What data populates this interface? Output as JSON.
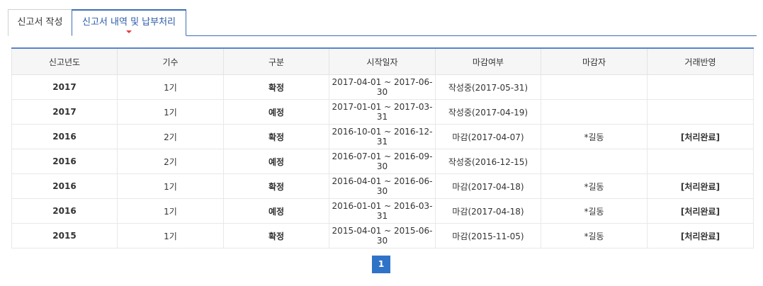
{
  "tabs": [
    {
      "label": "신고서 작성"
    },
    {
      "label": "신고서 내역 및 납부처리"
    }
  ],
  "table": {
    "headers": [
      "신고년도",
      "기수",
      "구분",
      "시작일자",
      "마감여부",
      "마감자",
      "거래반영"
    ],
    "rows": [
      {
        "year": "2017",
        "term": "1기",
        "kind": "확정",
        "period": "2017-04-01 ~ 2017-06-30",
        "status": "작성중(2017-05-31)",
        "closer": "",
        "reflect": ""
      },
      {
        "year": "2017",
        "term": "1기",
        "kind": "예정",
        "period": "2017-01-01 ~ 2017-03-31",
        "status": "작성중(2017-04-19)",
        "closer": "",
        "reflect": ""
      },
      {
        "year": "2016",
        "term": "2기",
        "kind": "확정",
        "period": "2016-10-01 ~ 2016-12-31",
        "status": "마감(2017-04-07)",
        "closer": "*길동",
        "reflect": "[처리완료]"
      },
      {
        "year": "2016",
        "term": "2기",
        "kind": "예정",
        "period": "2016-07-01 ~ 2016-09-30",
        "status": "작성중(2016-12-15)",
        "closer": "",
        "reflect": ""
      },
      {
        "year": "2016",
        "term": "1기",
        "kind": "확정",
        "period": "2016-04-01 ~ 2016-06-30",
        "status": "마감(2017-04-18)",
        "closer": "*길동",
        "reflect": "[처리완료]"
      },
      {
        "year": "2016",
        "term": "1기",
        "kind": "예정",
        "period": "2016-01-01 ~ 2016-03-31",
        "status": "마감(2017-04-18)",
        "closer": "*길동",
        "reflect": "[처리완료]"
      },
      {
        "year": "2015",
        "term": "1기",
        "kind": "확정",
        "period": "2015-04-01 ~ 2015-06-30",
        "status": "마감(2015-11-05)",
        "closer": "*길동",
        "reflect": "[처리완료]"
      }
    ]
  },
  "pagination": {
    "current": "1"
  },
  "colors": {
    "accent": "#3f6fb5",
    "link": "#3b5bcc",
    "closed": "#e00000",
    "pager": "#2f73c8"
  }
}
